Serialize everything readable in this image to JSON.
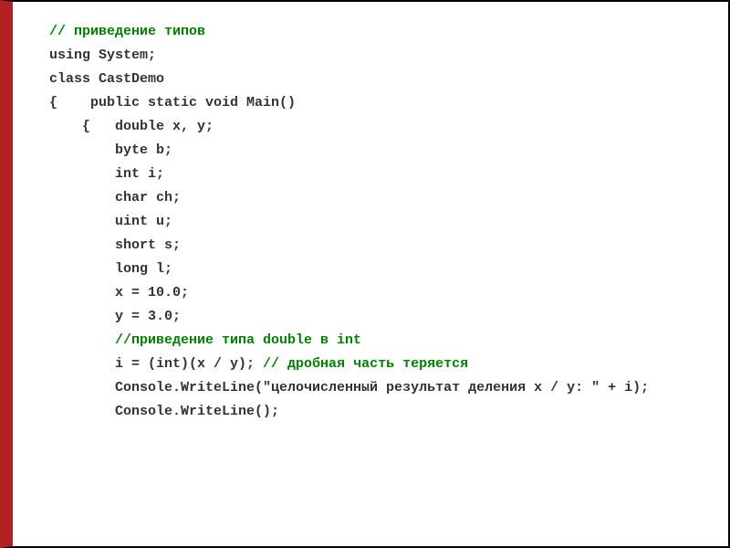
{
  "lines": {
    "l1": "// приведение типов",
    "l2": "using System;",
    "l3": "class CastDemo",
    "l4": "{    public static void Main()",
    "l5": "    {   double x, y;",
    "l6": "        byte b;",
    "l7": "        int i;",
    "l8": "        char ch;",
    "l9": "        uint u;",
    "l10": "        short s;",
    "l11": "        long l;",
    "l12": "        x = 10.0;",
    "l13": "        y = 3.0;",
    "l14": "        //приведение типа double в int",
    "l15a": "        i = (int)(x / y); ",
    "l15b": "// дробная часть теряется",
    "l16": "        Console.WriteLine(\"целочисленный результат деления x / y: \" + i);",
    "l17": "        Console.WriteLine();"
  }
}
